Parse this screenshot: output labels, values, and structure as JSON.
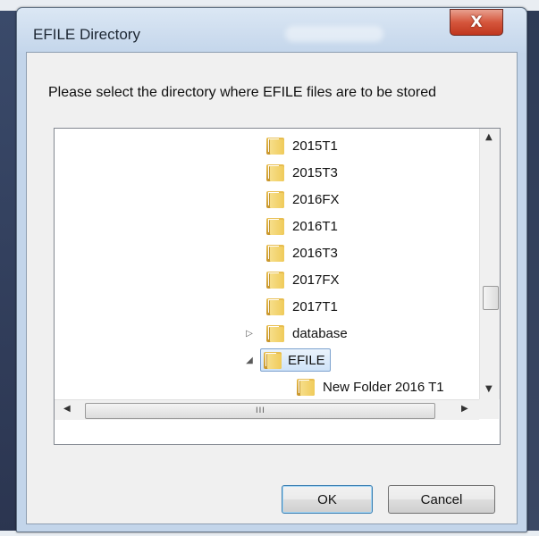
{
  "window": {
    "title": "EFILE Directory",
    "close_label": "X"
  },
  "prompt": "Please select the directory where EFILE files are to be stored",
  "tree": {
    "items": [
      {
        "label": "2015T1"
      },
      {
        "label": "2015T3"
      },
      {
        "label": "2016FX"
      },
      {
        "label": "2016T1"
      },
      {
        "label": "2016T3"
      },
      {
        "label": "2017FX"
      },
      {
        "label": "2017T1"
      },
      {
        "label": "database",
        "expander": "▷"
      },
      {
        "label": "EFILE",
        "expander": "◢",
        "selected": true
      },
      {
        "label": "New Folder 2016 T1"
      }
    ],
    "hscroll_grip": "III"
  },
  "buttons": {
    "ok": "OK",
    "cancel": "Cancel"
  },
  "colors": {
    "accent": "#3c7fb1",
    "close": "#c0371f",
    "folder": "#f0cb5a"
  }
}
